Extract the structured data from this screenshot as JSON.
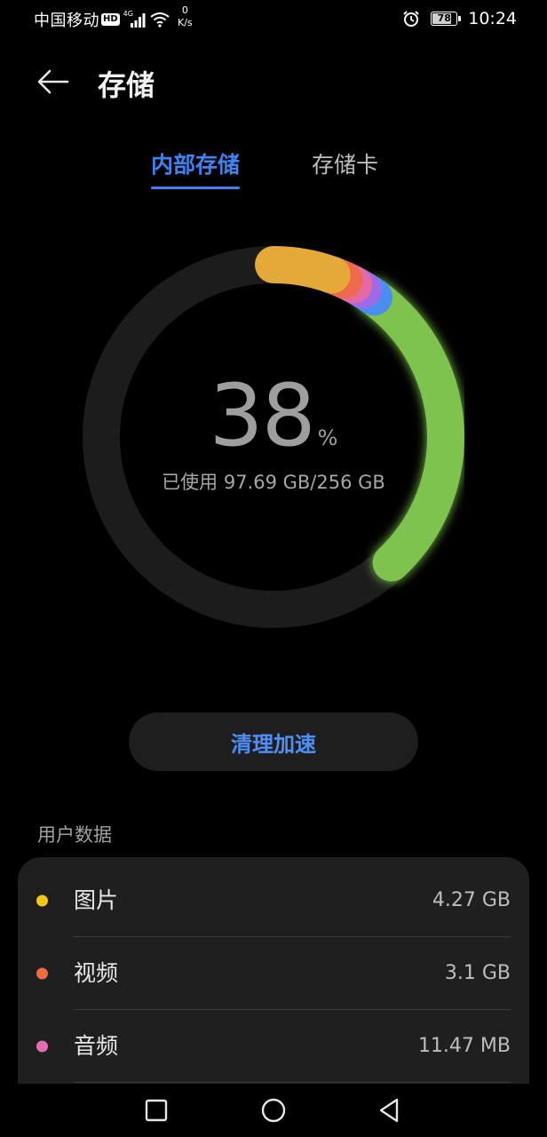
{
  "status_bar": {
    "carrier": "中国移动",
    "hd_badge": "HD",
    "network_type": "4G",
    "net_speed_value": "0",
    "net_speed_unit": "K/s",
    "battery_level": "78",
    "battery_fraction": 0.78,
    "time": "10:24",
    "icons": [
      "signal-bars-icon",
      "wifi-icon",
      "alarm-icon",
      "battery-icon"
    ]
  },
  "header": {
    "back_icon": "arrow-left-icon",
    "title": "存储"
  },
  "tabs": [
    {
      "label": "内部存储",
      "selected": true
    },
    {
      "label": "存储卡",
      "selected": false
    }
  ],
  "storage": {
    "percent": "38",
    "percent_sign": "%",
    "used_text": "已使用 97.69 GB/256 GB",
    "used_fraction": 0.38,
    "segments": [
      {
        "name": "pictures",
        "color": "#e5a93a",
        "fraction": 0.055
      },
      {
        "name": "videos",
        "color": "#ef6a4a",
        "fraction": 0.012
      },
      {
        "name": "audio",
        "color": "#e46aa6",
        "fraction": 0.01
      },
      {
        "name": "purple",
        "color": "#9f6ae6",
        "fraction": 0.01
      },
      {
        "name": "blue",
        "color": "#4b8ef2",
        "fraction": 0.012
      },
      {
        "name": "green",
        "color": "#7dc34e",
        "fraction": 0.281
      }
    ]
  },
  "actions": {
    "clean_label": "清理加速"
  },
  "user_data": {
    "section_title": "用户数据",
    "items": [
      {
        "label": "图片",
        "size": "4.27 GB",
        "color": "#f3c81a"
      },
      {
        "label": "视频",
        "size": "3.1 GB",
        "color": "#ef6a45"
      },
      {
        "label": "音频",
        "size": "11.47 MB",
        "color": "#e86ab0"
      }
    ]
  },
  "nav_bar": {
    "icons": [
      "recents-square-icon",
      "home-circle-icon",
      "back-triangle-icon"
    ]
  }
}
